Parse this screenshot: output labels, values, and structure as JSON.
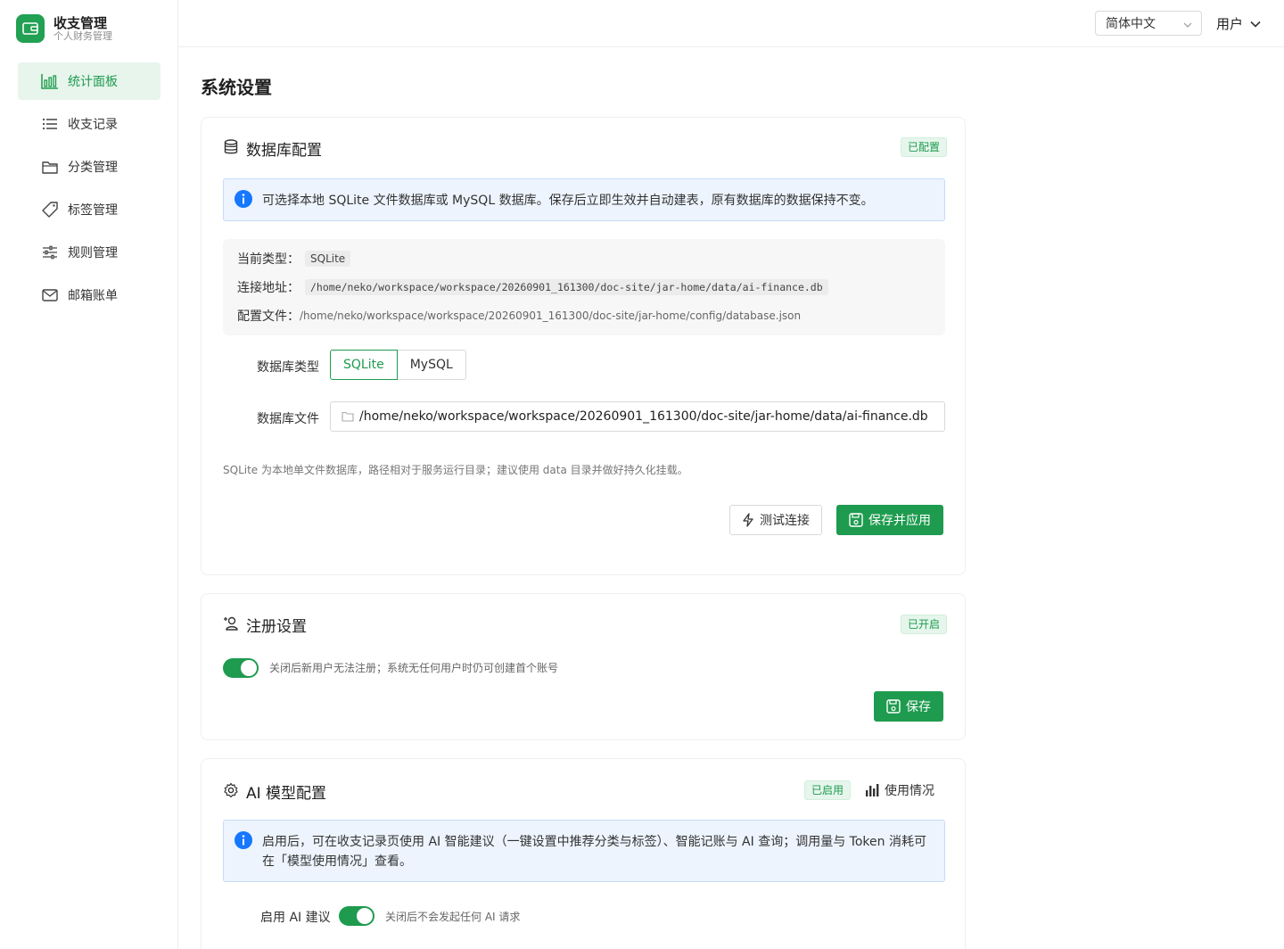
{
  "sidebar": {
    "brand_title": "收支管理",
    "brand_subtitle": "个人财务管理",
    "items": [
      {
        "label": "统计面板",
        "icon": "bar-chart-icon",
        "active": true
      },
      {
        "label": "收支记录",
        "icon": "list-icon"
      },
      {
        "label": "分类管理",
        "icon": "folder-icon"
      },
      {
        "label": "标签管理",
        "icon": "tag-icon"
      },
      {
        "label": "规则管理",
        "icon": "sliders-icon"
      },
      {
        "label": "邮箱账单",
        "icon": "mail-icon"
      }
    ]
  },
  "header": {
    "language": "简体中文",
    "user": "用户"
  },
  "page": {
    "title": "系统设置"
  },
  "db_card": {
    "title": "数据库配置",
    "status": "已配置",
    "info": "可选择本地 SQLite 文件数据库或 MySQL 数据库。保存后立即生效并自动建表，原有数据库的数据保持不变。",
    "current_type_label": "当前类型：",
    "current_type_value": "SQLite",
    "conn_label": "连接地址：",
    "conn_value": "/home/neko/workspace/workspace/20260901_161300/doc-site/jar-home/data/ai-finance.db",
    "config_label": "配置文件：",
    "config_value": "/home/neko/workspace/workspace/20260901_161300/doc-site/jar-home/config/database.json",
    "type_label": "数据库类型",
    "type_options": [
      "SQLite",
      "MySQL"
    ],
    "file_label": "数据库文件",
    "file_value": "/home/neko/workspace/workspace/20260901_161300/doc-site/jar-home/data/ai-finance.db",
    "hint": "SQLite 为本地单文件数据库，路径相对于服务运行目录；建议使用 data 目录并做好持久化挂载。",
    "test_button": "测试连接",
    "save_button": "保存并应用"
  },
  "reg_card": {
    "title": "注册设置",
    "status": "已开启",
    "switch_desc": "关闭后新用户无法注册；系统无任何用户时仍可创建首个账号",
    "save_button": "保存"
  },
  "ai_card": {
    "title": "AI 模型配置",
    "status": "已启用",
    "usage_link": "使用情况",
    "info_line1": "启用后，可在收支记录页使用 AI 智能建议（一键设置中推荐分类与标签）、智能记账与 AI 查询；调用量与 Token 消耗可",
    "info_line2": "在「模型使用情况」查看。",
    "enable_label": "启用 AI 建议",
    "enable_desc": "关闭后不会发起任何 AI 请求"
  },
  "colors": {
    "accent": "#1e9b4f",
    "info_bg": "#edf4fe",
    "info_icon": "#1677ff"
  }
}
